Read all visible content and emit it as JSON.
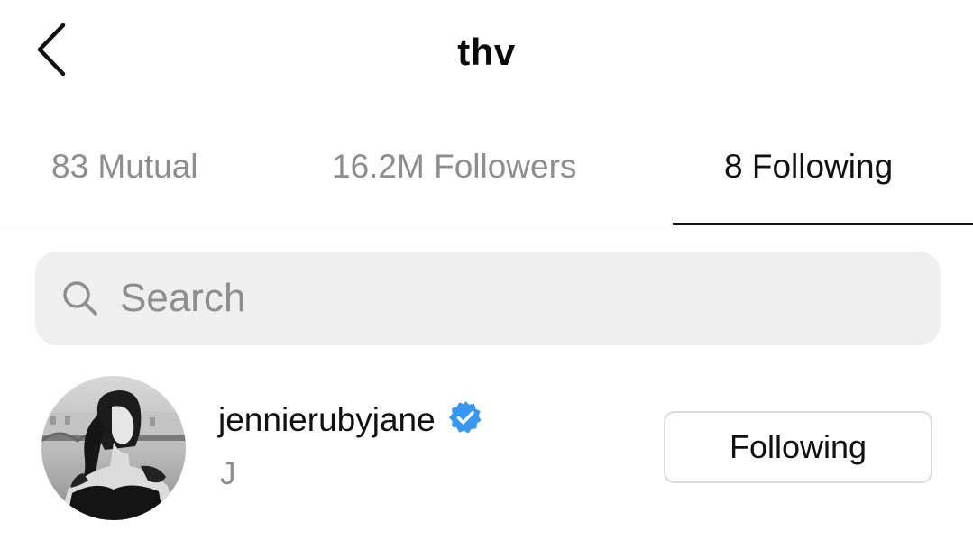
{
  "header": {
    "title": "thv",
    "back_icon": "chevron-left-icon"
  },
  "tabs": [
    {
      "label": "83 Mutual",
      "active": false
    },
    {
      "label": "16.2M Followers",
      "active": false
    },
    {
      "label": "8 Following",
      "active": true
    }
  ],
  "search": {
    "placeholder": "Search",
    "value": "",
    "icon": "search-icon"
  },
  "following_list": [
    {
      "username": "jennierubyjane",
      "full_name": "J",
      "verified": true,
      "button_label": "Following"
    }
  ],
  "colors": {
    "text_primary": "#111111",
    "text_secondary": "#8e8e8e",
    "search_bg": "#efefef",
    "divider": "#d6d6d6",
    "verified_blue": "#3897f0",
    "button_border": "#dbdbdb"
  }
}
